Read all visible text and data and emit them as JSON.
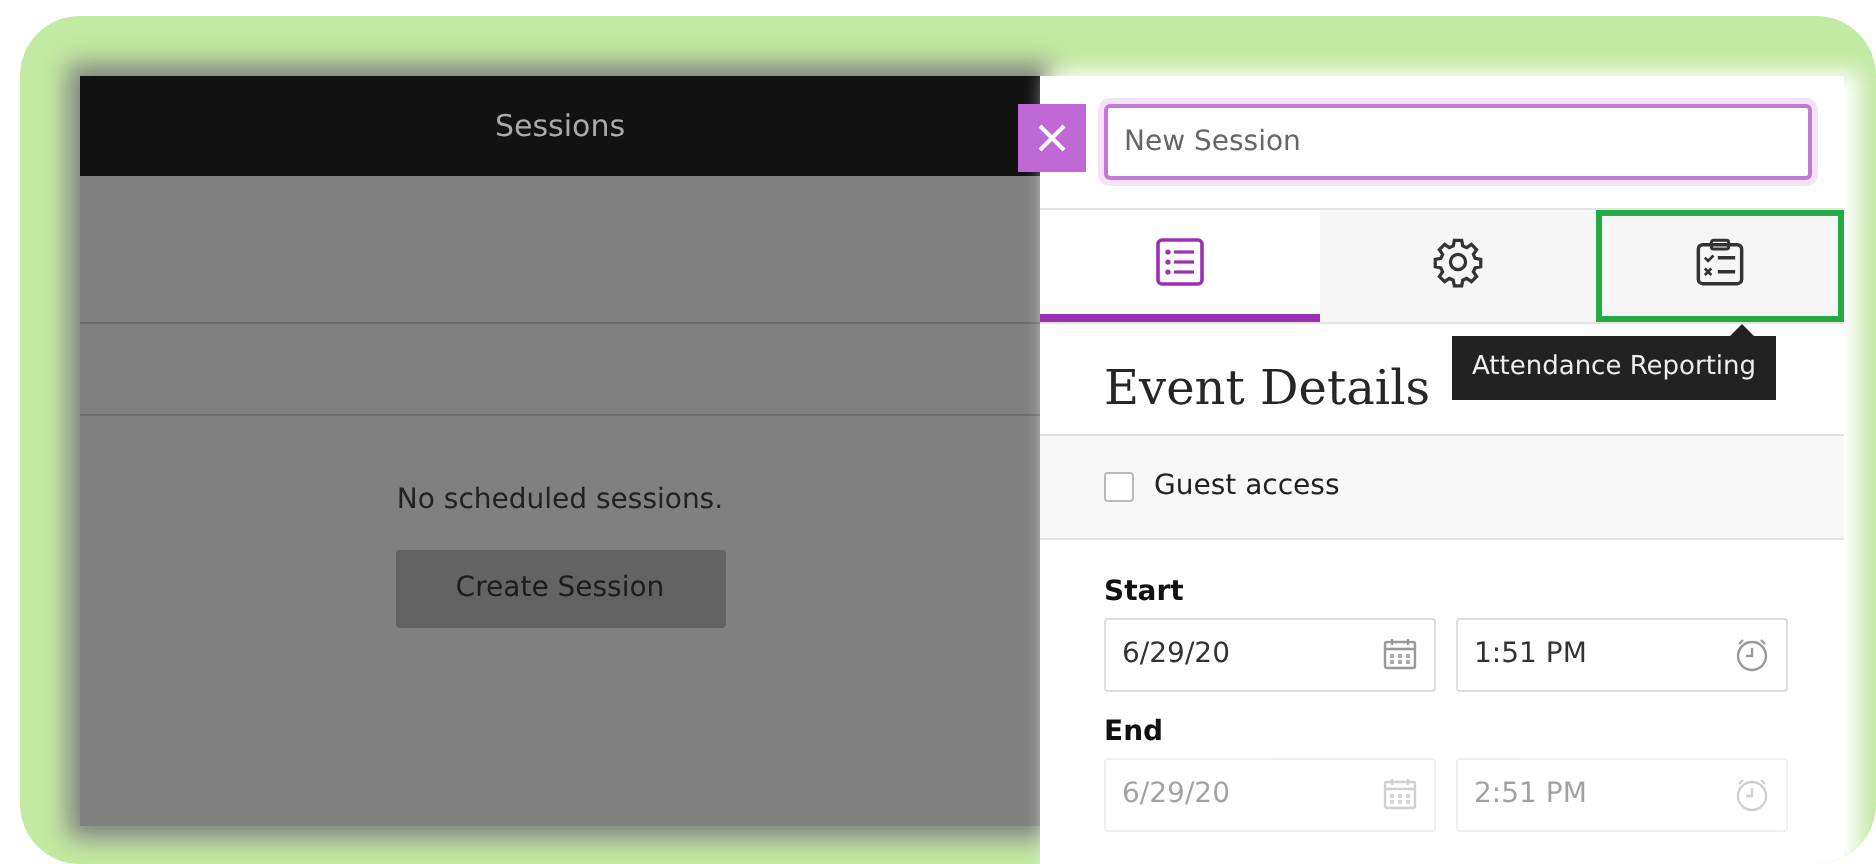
{
  "left_panel": {
    "title": "Sessions",
    "empty_message": "No scheduled sessions.",
    "create_button": "Create Session"
  },
  "session_name": {
    "placeholder": "New Session"
  },
  "tabs": [
    {
      "kind": "details",
      "selected": true,
      "highlighted": false
    },
    {
      "kind": "settings",
      "selected": false,
      "highlighted": false
    },
    {
      "kind": "attendance",
      "selected": false,
      "highlighted": true
    }
  ],
  "tooltip": "Attendance Reporting",
  "heading": "Event Details",
  "guest_access": {
    "label": "Guest access",
    "checked": false
  },
  "start": {
    "label": "Start",
    "date": "6/29/20",
    "time": "1:51 PM"
  },
  "end": {
    "label": "End",
    "date": "6/29/20",
    "time": "2:51 PM"
  }
}
